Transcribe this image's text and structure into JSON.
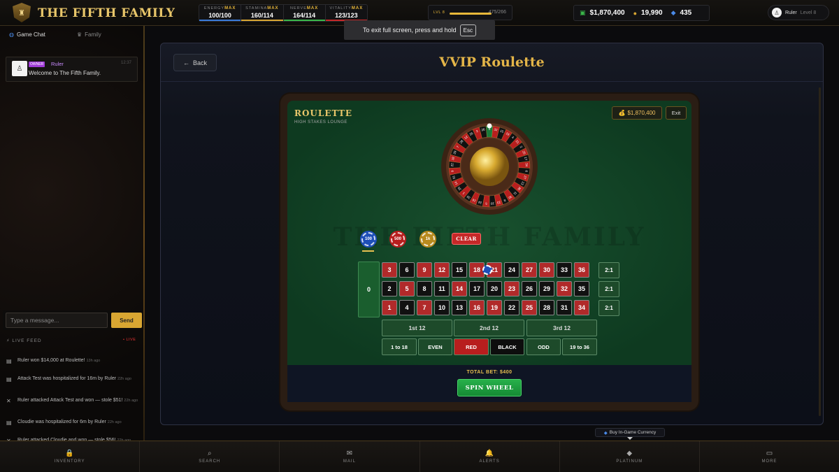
{
  "brand": "THE FIFTH FAMILY",
  "stats": [
    {
      "label": "ENERGY",
      "tag": "MAX",
      "value": "100/100",
      "color": "#3a7ad8"
    },
    {
      "label": "STAMINA",
      "tag": "MAX",
      "value": "160/114",
      "color": "#d8a632"
    },
    {
      "label": "NERVE",
      "tag": "MAX",
      "value": "164/114",
      "color": "#3ab84a"
    },
    {
      "label": "VITALITY",
      "tag": "MAX",
      "value": "123/123",
      "color": "#c62828"
    }
  ],
  "level": {
    "label": "LVL 8",
    "xp": "475/266",
    "progress_pct": 100
  },
  "currency": {
    "cash": "$1,870,400",
    "coins": "19,990",
    "gems": "435"
  },
  "user": {
    "name": "Ruler",
    "level": "Level 8"
  },
  "toast": {
    "text": "To exit full screen, press and hold",
    "key": "Esc"
  },
  "sidebar": {
    "tabs": [
      "Game Chat",
      "Family"
    ],
    "chat": [
      {
        "badge": "OWNER",
        "name": "Ruler",
        "time": "12:37",
        "text": "Welcome to The Fifth Family."
      }
    ],
    "input_placeholder": "Type a message...",
    "send_label": "Send",
    "feed_title": "LIVE FEED",
    "feed_live": "• LIVE",
    "feed": [
      {
        "icon": "scroll-icon",
        "text": "Ruler won $14,000 at Roulette!",
        "ago": "13h ago"
      },
      {
        "icon": "scroll-icon",
        "text": "Attack Test was hospitalized for 16m by Ruler",
        "ago": "22h ago"
      },
      {
        "icon": "swords-icon",
        "text": "Ruler attacked Attack Test and won — stole $51!",
        "ago": "22h ago"
      },
      {
        "icon": "scroll-icon",
        "text": "Cloudie was hospitalized for 6m by Ruler",
        "ago": "22h ago"
      },
      {
        "icon": "swords-icon",
        "text": "Ruler attacked Cloudie and won — stole $56!",
        "ago": "22h ago"
      }
    ]
  },
  "main": {
    "back_label": "Back",
    "title": "VVIP Roulette",
    "roulette_title": "ROULETTE",
    "roulette_subtitle": "HIGH STAKES LOUNGE",
    "balance": "$1,870,400",
    "exit_label": "Exit",
    "watermark": "THE FIFTH FAMILY",
    "chips": [
      "100",
      "500",
      "1k"
    ],
    "clear_label": "CLEAR",
    "zero": "0",
    "rows": [
      [
        {
          "n": "3",
          "c": "red"
        },
        {
          "n": "6",
          "c": "black"
        },
        {
          "n": "9",
          "c": "red"
        },
        {
          "n": "12",
          "c": "red"
        },
        {
          "n": "15",
          "c": "black"
        },
        {
          "n": "18",
          "c": "red"
        },
        {
          "n": "21",
          "c": "red"
        },
        {
          "n": "24",
          "c": "black"
        },
        {
          "n": "27",
          "c": "red"
        },
        {
          "n": "30",
          "c": "red"
        },
        {
          "n": "33",
          "c": "black"
        },
        {
          "n": "36",
          "c": "red"
        }
      ],
      [
        {
          "n": "2",
          "c": "black"
        },
        {
          "n": "5",
          "c": "red"
        },
        {
          "n": "8",
          "c": "black"
        },
        {
          "n": "11",
          "c": "black"
        },
        {
          "n": "14",
          "c": "red"
        },
        {
          "n": "17",
          "c": "black"
        },
        {
          "n": "20",
          "c": "black"
        },
        {
          "n": "23",
          "c": "red"
        },
        {
          "n": "26",
          "c": "black"
        },
        {
          "n": "29",
          "c": "black"
        },
        {
          "n": "32",
          "c": "red"
        },
        {
          "n": "35",
          "c": "black"
        }
      ],
      [
        {
          "n": "1",
          "c": "red"
        },
        {
          "n": "4",
          "c": "black"
        },
        {
          "n": "7",
          "c": "red"
        },
        {
          "n": "10",
          "c": "black"
        },
        {
          "n": "13",
          "c": "black"
        },
        {
          "n": "16",
          "c": "red"
        },
        {
          "n": "19",
          "c": "red"
        },
        {
          "n": "22",
          "c": "black"
        },
        {
          "n": "25",
          "c": "red"
        },
        {
          "n": "28",
          "c": "black"
        },
        {
          "n": "31",
          "c": "black"
        },
        {
          "n": "34",
          "c": "red"
        }
      ]
    ],
    "column_bets": [
      "2:1",
      "2:1",
      "2:1"
    ],
    "dozens": [
      "1st 12",
      "2nd 12",
      "3rd 12"
    ],
    "outside": [
      "1 to 18",
      "EVEN",
      "RED",
      "BLACK",
      "ODD",
      "19 to 36"
    ],
    "total_bet": "TOTAL BET: $400",
    "spin_label": "SPIN WHEEL"
  },
  "buy_currency": "Buy In-Game Currency",
  "nav": [
    {
      "icon": "lock-icon",
      "label": "INVENTORY"
    },
    {
      "icon": "search-icon",
      "label": "SEARCH"
    },
    {
      "icon": "mail-icon",
      "label": "MAIL"
    },
    {
      "icon": "bell-icon",
      "label": "ALERTS"
    },
    {
      "icon": "diamond-icon",
      "label": "PLATINUM"
    },
    {
      "icon": "more-icon",
      "label": "MORE"
    }
  ],
  "wheel": {
    "order": [
      "0",
      "32",
      "15",
      "19",
      "4",
      "21",
      "2",
      "25",
      "17",
      "34",
      "6",
      "27",
      "13",
      "36",
      "11",
      "30",
      "8",
      "23",
      "10",
      "5",
      "24",
      "16",
      "33",
      "1",
      "20",
      "14",
      "31",
      "9",
      "22",
      "18",
      "29",
      "7",
      "28",
      "12",
      "35",
      "3",
      "26"
    ]
  }
}
